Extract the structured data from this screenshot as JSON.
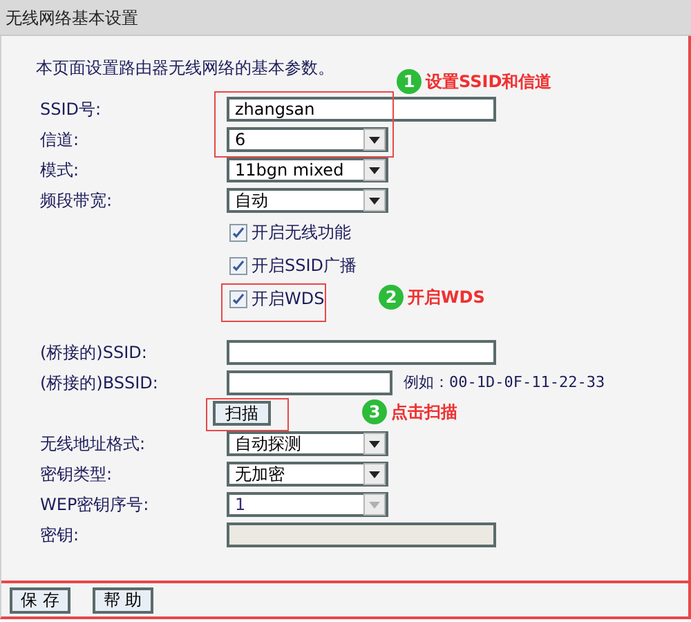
{
  "window": {
    "title": "无线网络基本设置"
  },
  "intro": "本页面设置路由器无线网络的基本参数。",
  "fields": [
    {
      "kind": "text",
      "label": "SSID号:",
      "value": "zhangsan",
      "disabled": false
    },
    {
      "kind": "select",
      "label": "信道:",
      "value": "6",
      "disabled": false
    },
    {
      "kind": "select",
      "label": "模式:",
      "value": "11bgn mixed",
      "disabled": false
    },
    {
      "kind": "select",
      "label": "频段带宽:",
      "value": "自动",
      "disabled": false
    },
    {
      "kind": "checkbox",
      "text": "开启无线功能",
      "checked": true
    },
    {
      "kind": "checkbox",
      "text": "开启SSID广播",
      "checked": true
    },
    {
      "kind": "checkbox",
      "text": "开启WDS",
      "checked": true
    },
    {
      "kind": "text",
      "label": "(桥接的)SSID:",
      "disabled": false
    },
    {
      "kind": "short",
      "label": "(桥接的)BSSID:",
      "hint": "例如：00-1D-0F-11-22-33"
    },
    {
      "kind": "button",
      "text": "扫描"
    },
    {
      "kind": "select",
      "label": "无线地址格式:",
      "value": "自动探测",
      "disabled": false
    },
    {
      "kind": "select",
      "label": "密钥类型:",
      "value": "无加密",
      "disabled": false
    },
    {
      "kind": "select",
      "label": "WEP密钥序号:",
      "value": "1",
      "disabled": true
    },
    {
      "kind": "text",
      "label": "密钥:",
      "disabled": true
    }
  ],
  "annotations": [
    {
      "number": "1",
      "text": "设置SSID和信道"
    },
    {
      "number": "2",
      "text": "开启WDS"
    },
    {
      "number": "3",
      "text": "点击扫描"
    }
  ],
  "buttons": [
    "保 存",
    "帮 助"
  ]
}
